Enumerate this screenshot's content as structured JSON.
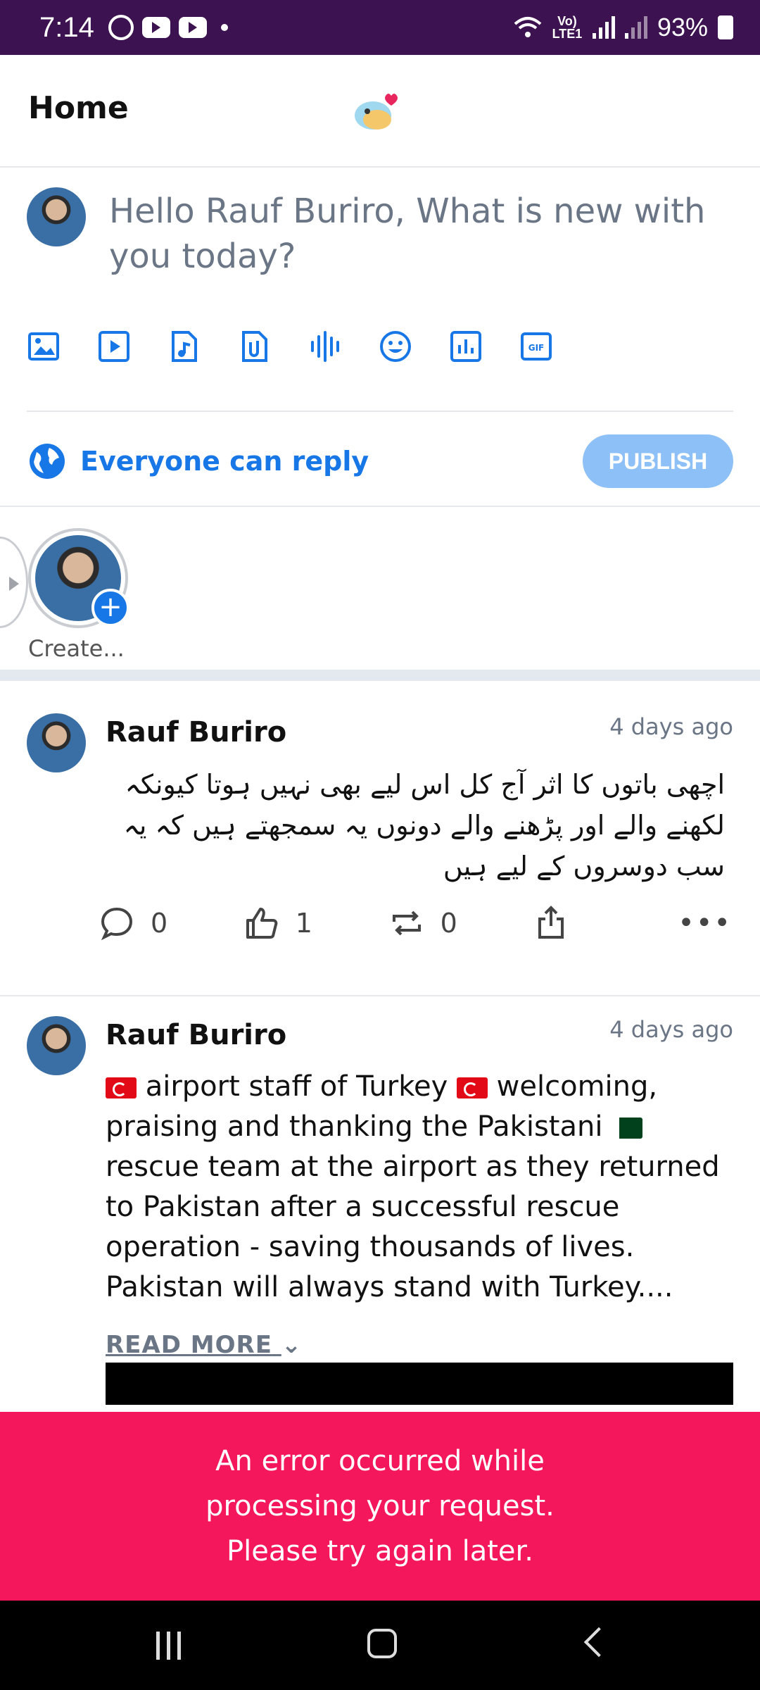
{
  "status_bar": {
    "time": "7:14",
    "battery": "93%",
    "network": "Vo) LTE1"
  },
  "header": {
    "title": "Home"
  },
  "composer": {
    "placeholder": "Hello Rauf Buriro, What is new with you today?",
    "tools": [
      "image-icon",
      "video-icon",
      "audio-file-icon",
      "attachment-icon",
      "voice-icon",
      "emoji-icon",
      "poll-icon",
      "gif-icon"
    ],
    "reply_setting": "Everyone can reply",
    "publish_label": "PUBLISH"
  },
  "stories": {
    "create_label": "Create..."
  },
  "posts": [
    {
      "author": "Rauf Buriro",
      "time": "4 days ago",
      "text": "اچھی باتوں کا اثر آج کل اس لیے بھی نہیں ہوتا کیونکہ لکھنے والے اور پڑھنے والے دونوں یہ سمجھتے ہیں کہ یہ سب دوسروں کے لیے ہیں",
      "comments": "0",
      "likes": "1",
      "reposts": "0"
    },
    {
      "author": "Rauf Buriro",
      "time": "4 days ago",
      "text_part1": " airport staff of Turkey ",
      "text_part2": " welcoming, praising and thanking the Pakistani ",
      "text_part3": " rescue team at the airport as they returned to Pakistan after a successful rescue operation - saving thousands of lives. Pakistan will always stand with Turkey....",
      "read_more": "READ MORE"
    }
  ],
  "error_toast": "An error occurred while processing your request. Please try again later.",
  "colors": {
    "accent": "#1877e6",
    "status_bar": "#3d1250",
    "error": "#f5175b",
    "publish_disabled": "#8dc0f7"
  }
}
